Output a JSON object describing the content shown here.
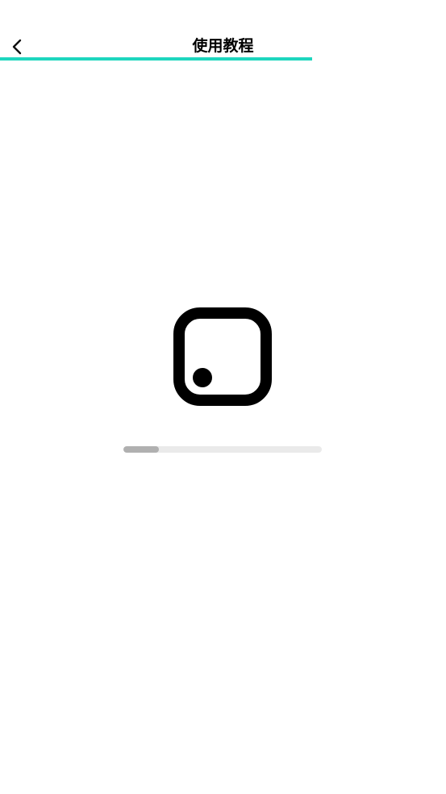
{
  "header": {
    "back_icon": "chevron-left-icon",
    "title": "使用教程",
    "page_load_progress": 0.7,
    "accent_color": "#1ed6be"
  },
  "loader": {
    "icon": "app-placeholder-icon",
    "progress": 0.18,
    "track_color": "#eaeaea",
    "fill_color": "#b0b0b0"
  }
}
